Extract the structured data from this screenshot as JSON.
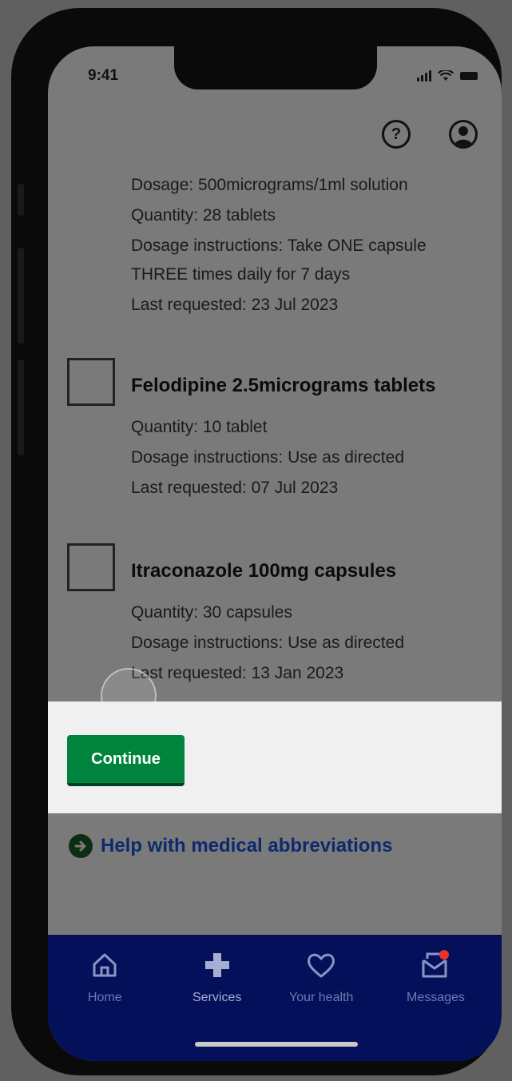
{
  "status_bar": {
    "time": "9:41"
  },
  "header": {
    "help_icon_glyph": "?",
    "help_icon": "question-circle-icon",
    "profile_icon": "user-circle-icon"
  },
  "partial_item": {
    "dosage": "Dosage: 500micrograms/1ml solution",
    "quantity": "Quantity: 28 tablets",
    "instructions_line1": "Dosage instructions: Take ONE capsule",
    "instructions_line2": "THREE times daily for 7 days",
    "last_requested": "Last requested: 23 Jul 2023"
  },
  "medications": [
    {
      "name": "Felodipine 2.5micrograms tablets",
      "quantity": "Quantity: 10 tablet",
      "instructions": "Dosage instructions: Use as directed",
      "last_requested": "Last requested: 07 Jul 2023",
      "checked": false
    },
    {
      "name": "Itraconazole 100mg capsules",
      "quantity": "Quantity: 30 capsules",
      "instructions": "Dosage instructions: Use as directed",
      "last_requested": "Last requested: 13 Jan 2023",
      "checked": false
    }
  ],
  "actions": {
    "continue_label": "Continue",
    "help_link_label": "Help with medical abbreviations",
    "help_link_icon": "arrow-right-circle-icon"
  },
  "tab_bar": {
    "items": [
      {
        "label": "Home",
        "icon": "home-icon"
      },
      {
        "label": "Services",
        "icon": "plus-icon"
      },
      {
        "label": "Your health",
        "icon": "heart-icon"
      },
      {
        "label": "Messages",
        "icon": "messages-icon"
      }
    ]
  },
  "colors": {
    "primary_button": "#00843d",
    "link_blue": "#0d2a6e",
    "tab_bar_background": "#05105a",
    "notification_dot": "#e8342b"
  }
}
